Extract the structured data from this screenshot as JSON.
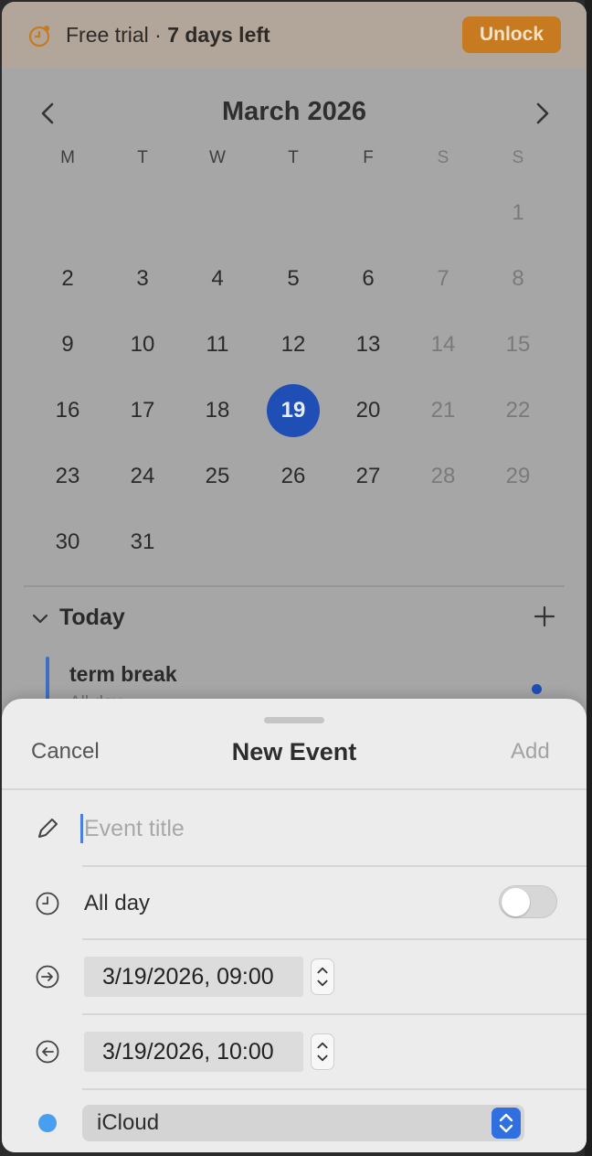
{
  "trial_banner": {
    "prefix": "Free trial · ",
    "days_left": "7 days left",
    "unlock_label": "Unlock",
    "accent": "#c77a1f"
  },
  "calendar": {
    "month_title": "March 2026",
    "weekdays": [
      "M",
      "T",
      "W",
      "T",
      "F",
      "S",
      "S"
    ],
    "weeks": [
      [
        "",
        "",
        "",
        "",
        "",
        "",
        "1"
      ],
      [
        "2",
        "3",
        "4",
        "5",
        "6",
        "7",
        "8"
      ],
      [
        "9",
        "10",
        "11",
        "12",
        "13",
        "14",
        "15"
      ],
      [
        "16",
        "17",
        "18",
        "19",
        "20",
        "21",
        "22"
      ],
      [
        "23",
        "24",
        "25",
        "26",
        "27",
        "28",
        "29"
      ],
      [
        "30",
        "31",
        "",
        "",
        "",
        "",
        ""
      ]
    ],
    "selected_day": "19",
    "selected_color": "#1f4fb4"
  },
  "today_section": {
    "label": "Today",
    "events": [
      {
        "title": "term break",
        "subtitle": "All day"
      }
    ]
  },
  "new_event_sheet": {
    "cancel_label": "Cancel",
    "title": "New Event",
    "add_label": "Add",
    "title_placeholder": "Event title",
    "allday_label": "All day",
    "allday_on": false,
    "start": "3/19/2026, 09:00",
    "end": "3/19/2026, 10:00",
    "calendar_name": "iCloud",
    "calendar_color": "#4a9ef0"
  }
}
